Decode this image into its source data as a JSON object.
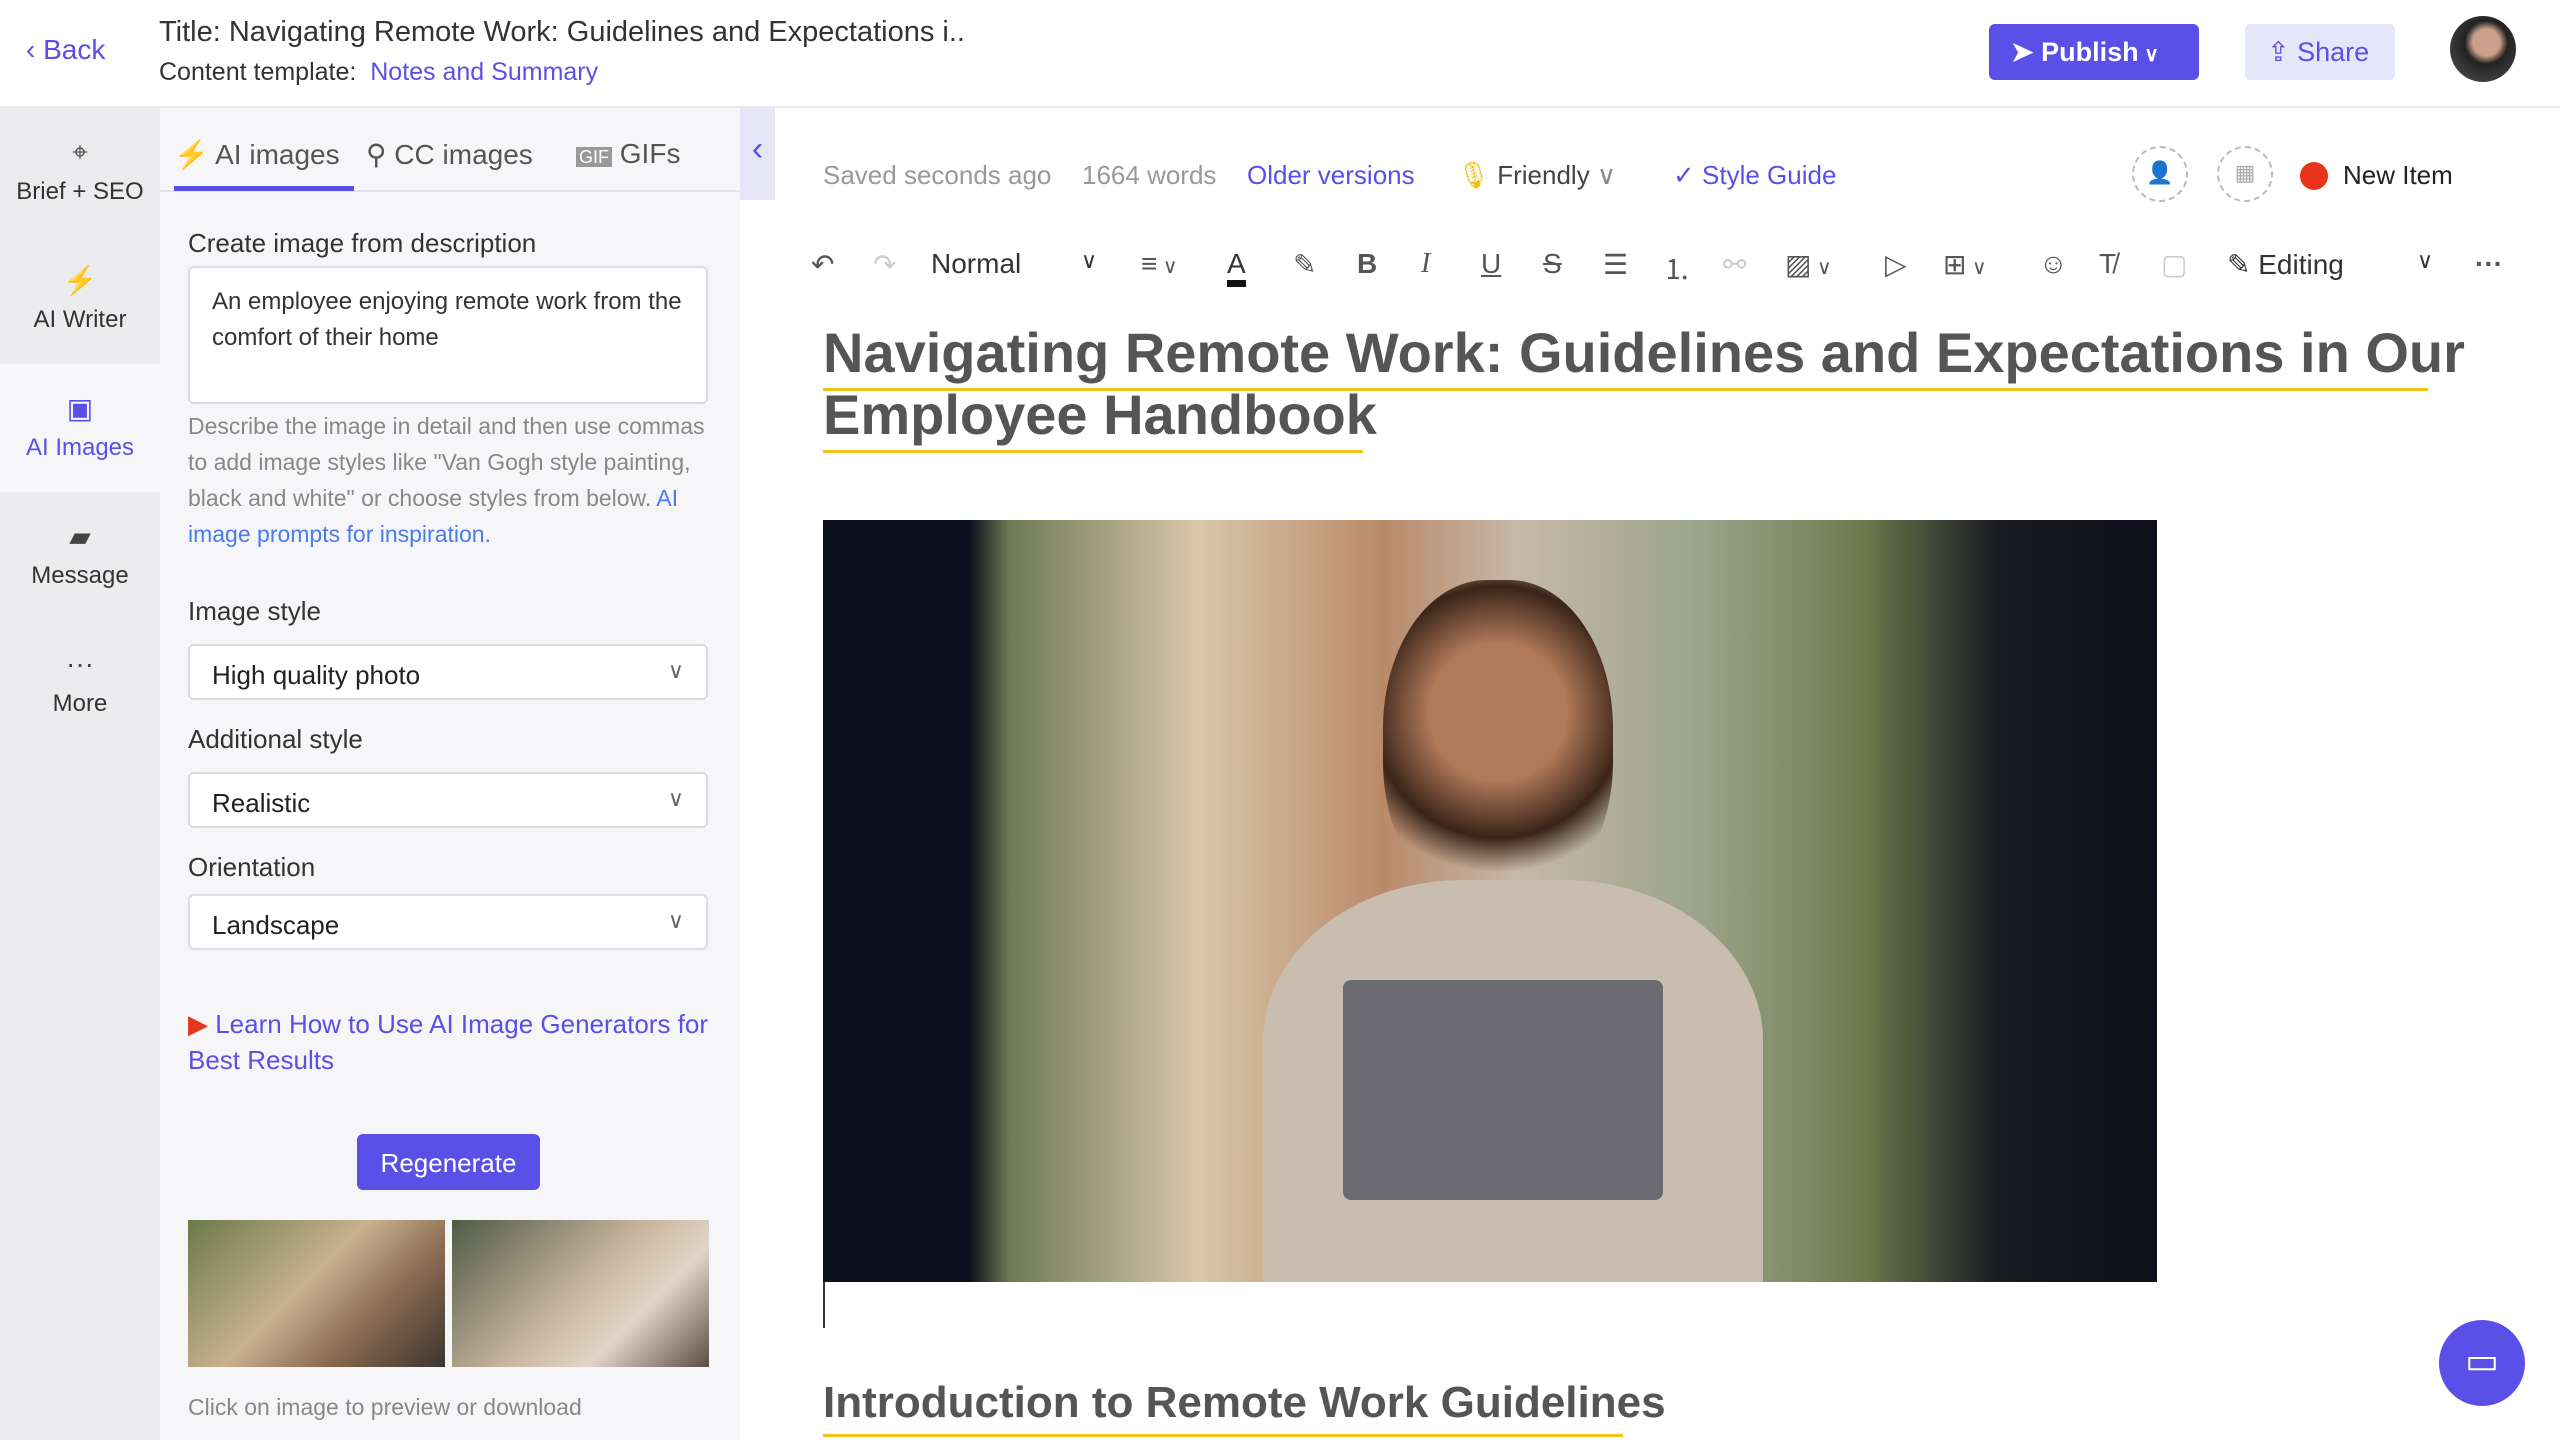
{
  "header": {
    "back": "Back",
    "title": "Title: Navigating Remote Work: Guidelines and Expectations i..",
    "template_label": "Content template:",
    "template_value": "Notes and Summary",
    "publish": "Publish",
    "share": "Share"
  },
  "rail": [
    {
      "label": "Brief + SEO",
      "icon": "crosshair-icon"
    },
    {
      "label": "AI Writer",
      "icon": "bolt-icon"
    },
    {
      "label": "AI Images",
      "icon": "image-icon"
    },
    {
      "label": "Message",
      "icon": "message-icon"
    },
    {
      "label": "More",
      "icon": "more-icon"
    }
  ],
  "panel": {
    "tabs": [
      "AI images",
      "CC images",
      "GIFs"
    ],
    "create_label": "Create image from description",
    "description": "An employee enjoying remote work from the comfort of their home",
    "help": "Describe the image in detail and then use commas to add image styles like \"Van Gogh style painting, black and white\" or choose styles from below.",
    "help_link": "AI image prompts for inspiration.",
    "image_style_label": "Image style",
    "image_style": "High quality photo",
    "additional_label": "Additional style",
    "additional": "Realistic",
    "orientation_label": "Orientation",
    "orientation": "Landscape",
    "learn_link": "Learn How to Use AI Image Generators for Best Results",
    "regenerate": "Regenerate",
    "footer": "Click on image to preview or download"
  },
  "status": {
    "saved": "Saved seconds ago",
    "words": "1664 words",
    "older": "Older versions",
    "tone": "Friendly",
    "style_guide": "Style Guide",
    "new_item": "New Item"
  },
  "toolbar": {
    "format": "Normal",
    "mode": "Editing"
  },
  "doc": {
    "title_line1": "Navigating Remote Work: Guidelines and Expectations in Our",
    "title_line2": "Employee Handbook",
    "h2": "Introduction to Remote Work Guidelines"
  },
  "colors": {
    "accent": "#5a4fe6",
    "highlight": "#f2c01a",
    "status_dot": "#e8341c"
  }
}
